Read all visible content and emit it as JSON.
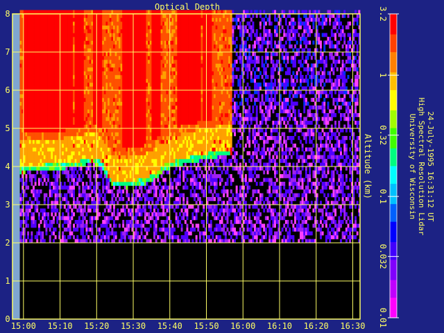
{
  "colors": {
    "background": "#1c2284",
    "axis": "#ffff66",
    "no_data": "#000000",
    "missing_column": "#7fa6d0"
  },
  "chart_data": {
    "type": "heatmap",
    "title": "Optical Depth",
    "xlabel": "",
    "ylabel": "Altitude (km)",
    "x_ticks": [
      "15:00",
      "15:10",
      "15:20",
      "15:30",
      "15:40",
      "15:50",
      "16:00",
      "16:10",
      "16:20",
      "16:30"
    ],
    "y_ticks": [
      0,
      1,
      2,
      3,
      4,
      5,
      6,
      7,
      8
    ],
    "xlim": [
      "14:57",
      "16:32"
    ],
    "ylim": [
      0,
      8
    ],
    "grid": true,
    "colorbar": {
      "scale": "log",
      "range": [
        0.01,
        3.2
      ],
      "ticks": [
        "0.01",
        "0.032",
        "0.1",
        "0.32",
        "1",
        "3.2"
      ],
      "colors": [
        "#ff40ff",
        "#a020f0",
        "#5000ff",
        "#0030ff",
        "#00a0ff",
        "#00ffff",
        "#00ff80",
        "#80ff00",
        "#ffff00",
        "#ffa000",
        "#ff5000",
        "#ff0000"
      ]
    },
    "side_text": [
      "University of Wisconsin",
      "High Spectral Resolution Lidar",
      "24-July-1995 16:31:12 UT"
    ],
    "data_gap_below_km": 2.0,
    "cloud_base_km": [
      {
        "time": "15:00",
        "alt": 3.8
      },
      {
        "time": "15:05",
        "alt": 3.85
      },
      {
        "time": "15:10",
        "alt": 3.88
      },
      {
        "time": "15:15",
        "alt": 3.95
      },
      {
        "time": "15:18",
        "alt": 4.05
      },
      {
        "time": "15:21",
        "alt": 3.95
      },
      {
        "time": "15:24",
        "alt": 3.45
      },
      {
        "time": "15:28",
        "alt": 3.4
      },
      {
        "time": "15:33",
        "alt": 3.5
      },
      {
        "time": "15:36",
        "alt": 3.65
      },
      {
        "time": "15:38",
        "alt": 3.85
      },
      {
        "time": "15:41",
        "alt": 3.95
      },
      {
        "time": "15:45",
        "alt": 4.05
      },
      {
        "time": "15:50",
        "alt": 4.15
      },
      {
        "time": "15:55",
        "alt": 4.25
      }
    ],
    "cloud_end_time": "15:57",
    "opaque_columns": [
      {
        "from": "15:00",
        "to": "15:13"
      },
      {
        "from": "15:14",
        "to": "15:16"
      },
      {
        "from": "15:19",
        "to": "15:21"
      },
      {
        "from": "15:27",
        "to": "15:33"
      },
      {
        "from": "15:35",
        "to": "15:37"
      },
      {
        "from": "15:42",
        "to": "15:48"
      },
      {
        "from": "15:49",
        "to": "15:51"
      }
    ]
  }
}
